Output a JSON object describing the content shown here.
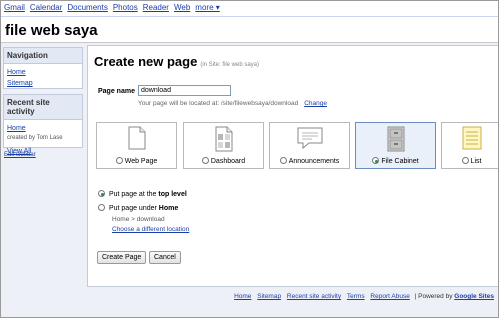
{
  "gbar": {
    "links": [
      "Gmail",
      "Calendar",
      "Documents",
      "Photos",
      "Reader",
      "Web"
    ],
    "more": "more ▾"
  },
  "site_title": "file web saya",
  "sidebar": {
    "nav_header": "Navigation",
    "nav_items": [
      "Home",
      "Sitemap"
    ],
    "activity_header": "Recent site activity",
    "activity_item": "Home",
    "activity_by": "created by Tom Lase",
    "view_all": "View All",
    "edit_sidebar": "Edit sidebar"
  },
  "main": {
    "title": "Create new page",
    "in_site": "(in Site: file web saya)",
    "page_name_label": "Page name",
    "page_name_value": "download",
    "location_hint": "Your page will be located at: /site/filewebsaya/download",
    "change_link": "Change",
    "templates": [
      {
        "label": "Web Page",
        "selected": false
      },
      {
        "label": "Dashboard",
        "selected": false
      },
      {
        "label": "Announcements",
        "selected": false
      },
      {
        "label": "File Cabinet",
        "selected": true
      },
      {
        "label": "List",
        "selected": false
      }
    ],
    "top_level_prefix": "Put page at the",
    "top_level_bold": "top level",
    "under_prefix": "Put page under",
    "under_bold": "Home",
    "breadcrumb_path": "Home > download",
    "choose_location": "Choose a different location",
    "create_button": "Create Page",
    "cancel_button": "Cancel"
  },
  "footer": {
    "links": [
      "Home",
      "Sitemap",
      "Recent site activity",
      "Terms",
      "Report Abuse"
    ],
    "powered_prefix": "| Powered by",
    "powered_brand": "Google Sites"
  },
  "colors": {
    "link": "#1a3fa8",
    "sidebar_header_bg": "#e3e9f4",
    "page_bg": "#eef0f7",
    "selected_card_border": "#6c8ebf"
  }
}
